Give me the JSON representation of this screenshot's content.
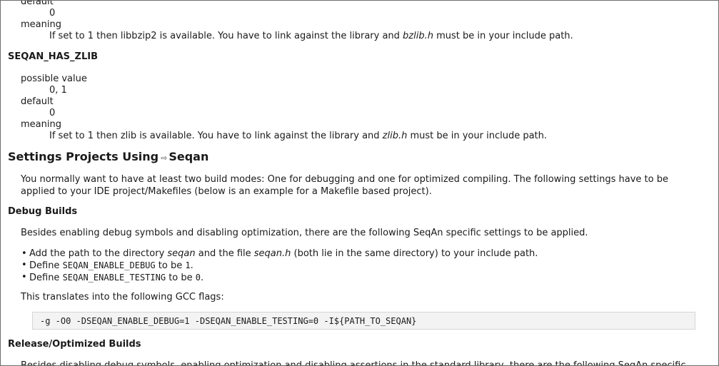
{
  "sec_bzip2": {
    "default_label": "default",
    "default_value": "0",
    "meaning_label": "meaning",
    "meaning_pre": "If set to 1 then libbzip2 is available. You have to link against the library and ",
    "meaning_file": "bzlib.h",
    "meaning_post": " must be in your include path."
  },
  "sec_zlib": {
    "heading": "SEQAN_HAS_ZLIB",
    "possible_label": "possible value",
    "possible_value": "0, 1",
    "default_label": "default",
    "default_value": "0",
    "meaning_label": "meaning",
    "meaning_pre": "If set to 1 then zlib is available. You have to link against the library and ",
    "meaning_file": "zlib.h",
    "meaning_post": " must be in your include path."
  },
  "settings": {
    "heading_pre": "Settings Projects Using",
    "link_icon": "⇨",
    "heading_link": "Seqan",
    "intro": "You normally want to have at least two build modes: One for debugging and one for optimized compiling. The following settings have to be applied to your IDE project/Makefiles (below is an example for a Makefile based project)."
  },
  "debug": {
    "heading": "Debug Builds",
    "intro": "Besides enabling debug symbols and disabling optimization, there are the following SeqAn specific settings to be applied.",
    "bullet1_pre": "Add the path to the directory ",
    "bullet1_dir": "seqan",
    "bullet1_mid": " and the file ",
    "bullet1_file": "seqan.h",
    "bullet1_post": " (both lie in the same directory) to your include path.",
    "bullet2_pre": "Define ",
    "bullet2_code": "SEQAN_ENABLE_DEBUG",
    "bullet2_mid": " to be ",
    "bullet2_val": "1",
    "bullet2_post": ".",
    "bullet3_pre": "Define ",
    "bullet3_code": "SEQAN_ENABLE_TESTING",
    "bullet3_mid": " to be ",
    "bullet3_val": "0",
    "bullet3_post": ".",
    "translates": "This translates into the following GCC flags:",
    "flags": "-g -O0 -DSEQAN_ENABLE_DEBUG=1 -DSEQAN_ENABLE_TESTING=0 -I${PATH_TO_SEQAN}"
  },
  "release": {
    "heading": "Release/Optimized Builds",
    "intro_partial": "Besides disabling debug symbols, enabling optimization and disabling assertions in the standard library, there are the following SeqAn specific"
  }
}
